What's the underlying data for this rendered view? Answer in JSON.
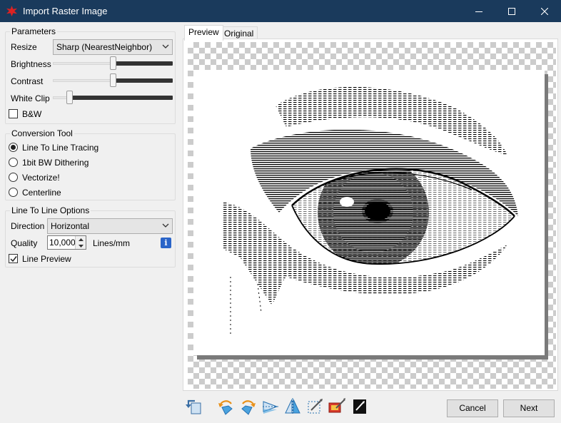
{
  "window": {
    "title": "Import Raster Image"
  },
  "parameters": {
    "group_label": "Parameters",
    "resize_label": "Resize",
    "resize_value": "Sharp (NearestNeighbor)",
    "brightness_label": "Brightness",
    "brightness_level": 0.5,
    "contrast_label": "Contrast",
    "contrast_level": 0.5,
    "white_clip_label": "White Clip",
    "white_clip_level": 0.12,
    "bw_label": "B&W",
    "bw_checked": false
  },
  "conversion_tool": {
    "group_label": "Conversion Tool",
    "options": [
      {
        "label": "Line To Line Tracing",
        "selected": true
      },
      {
        "label": "1bit BW Dithering",
        "selected": false
      },
      {
        "label": "Vectorize!",
        "selected": false
      },
      {
        "label": "Centerline",
        "selected": false
      }
    ]
  },
  "line_options": {
    "group_label": "Line To Line Options",
    "direction_label": "Direction",
    "direction_value": "Horizontal",
    "quality_label": "Quality",
    "quality_value": "10,000",
    "quality_unit": "Lines/mm",
    "info_glyph": "i",
    "line_preview_label": "Line Preview",
    "line_preview_checked": true
  },
  "tabs": [
    {
      "label": "Preview",
      "active": true
    },
    {
      "label": "Original",
      "active": false
    }
  ],
  "toolbar_icons": [
    "reset-icon",
    "rotate-left-icon",
    "rotate-right-icon",
    "flip-horizontal-icon",
    "flip-vertical-icon",
    "crop-icon",
    "auto-crop-icon",
    "invert-icon"
  ],
  "buttons": {
    "cancel": "Cancel",
    "next": "Next"
  },
  "colors": {
    "titlebar": "#1a3a5c",
    "accent": "#2a64c8"
  }
}
